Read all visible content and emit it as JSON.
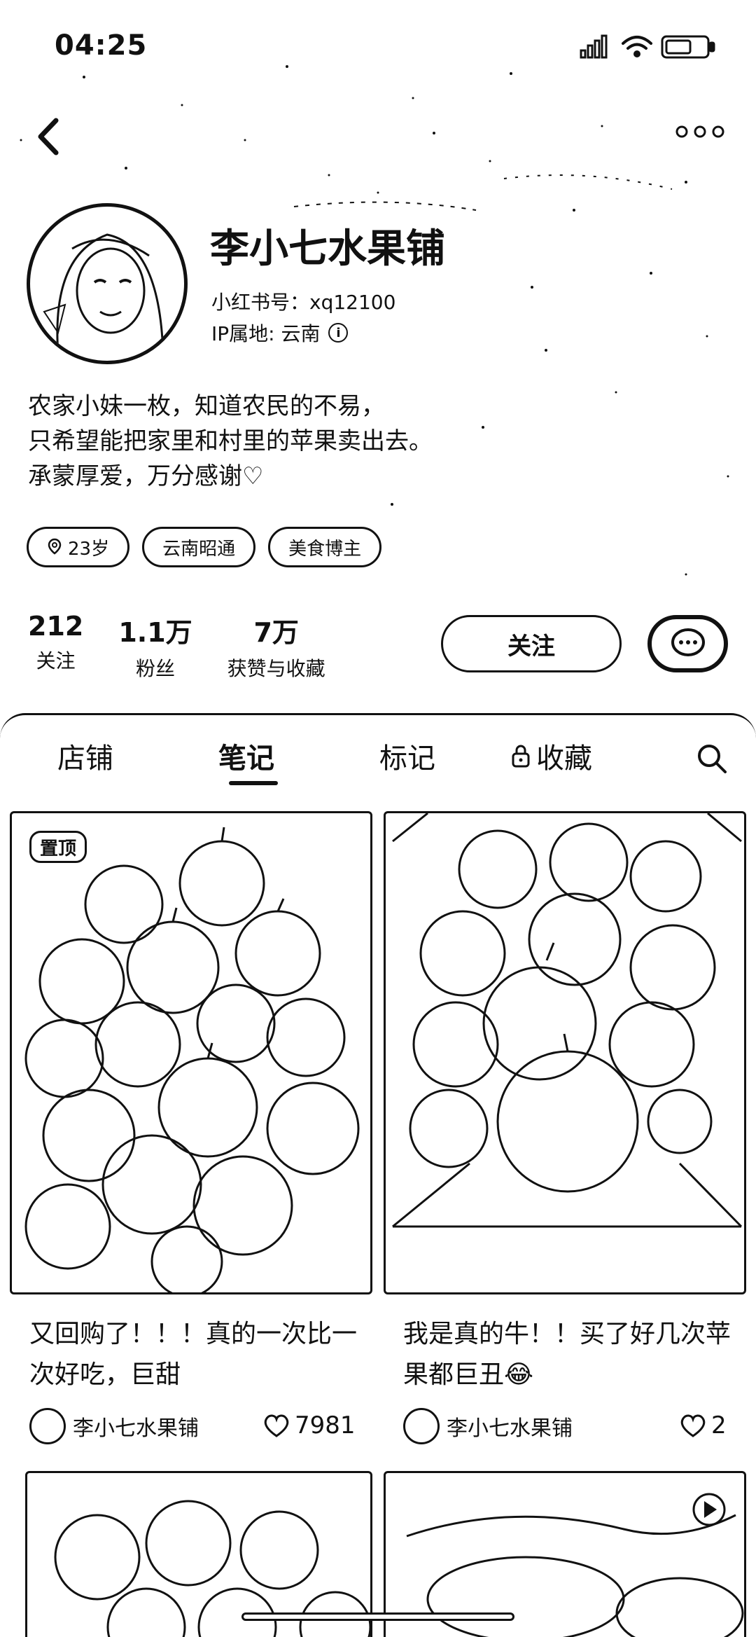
{
  "status": {
    "time": "04:25"
  },
  "profile": {
    "name": "李小七水果铺",
    "id_label": "小红书号：xq12100",
    "ip_label": "IP属地: 云南",
    "bio": [
      "农家小妹一枚，知道农民的不易，",
      "只希望能把家里和村里的苹果卖出去。",
      "承蒙厚爱，万分感谢♡"
    ],
    "tags": [
      "23岁",
      "云南昭通",
      "美食博主"
    ]
  },
  "stats": [
    {
      "num": "212",
      "label": "关注"
    },
    {
      "num": "1.1万",
      "label": "粉丝"
    },
    {
      "num": "7万",
      "label": "获赞与收藏"
    }
  ],
  "actions": {
    "follow_label": "关注"
  },
  "tabs": [
    {
      "label": "店铺"
    },
    {
      "label": "笔记"
    },
    {
      "label": "标记"
    },
    {
      "label": "收藏"
    }
  ],
  "active_tab": "笔记",
  "notes": [
    {
      "pinned_label": "置顶",
      "title": "又回购了！！！真的一次比一次好吃，巨甜",
      "author": "李小七水果铺",
      "likes": "7981"
    },
    {
      "title": "我是真的牛！！买了好几次苹果都巨丑😂",
      "author": "李小七水果铺",
      "likes": "2"
    }
  ]
}
